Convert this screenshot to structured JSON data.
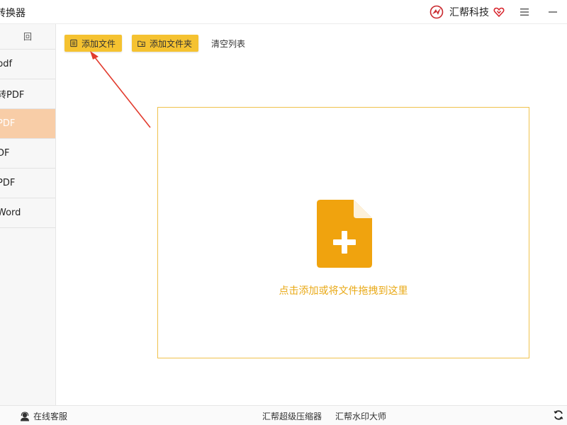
{
  "window": {
    "title": "转换器",
    "brand_name": "汇帮科技"
  },
  "sidebar": {
    "top_label": "回",
    "items": [
      {
        "label": "pdf"
      },
      {
        "label": "转PDF"
      },
      {
        "label": "PDF"
      },
      {
        "label": "DF"
      },
      {
        "label": "PDF"
      },
      {
        "label": "Word"
      }
    ]
  },
  "toolbar": {
    "add_file": "添加文件",
    "add_folder": "添加文件夹",
    "clear_list": "清空列表"
  },
  "dropzone": {
    "hint": "点击添加或将文件拖拽到这里"
  },
  "footer": {
    "support": "在线客服",
    "link1": "汇帮超级压缩器",
    "link2": "汇帮水印大师"
  },
  "colors": {
    "accent": "#f5c230",
    "drop_border": "#f0c24c",
    "drop_icon": "#f0a30e",
    "drop_text": "#e9a916",
    "active_item": "#f8cda7",
    "arrow": "#e23b2e"
  }
}
